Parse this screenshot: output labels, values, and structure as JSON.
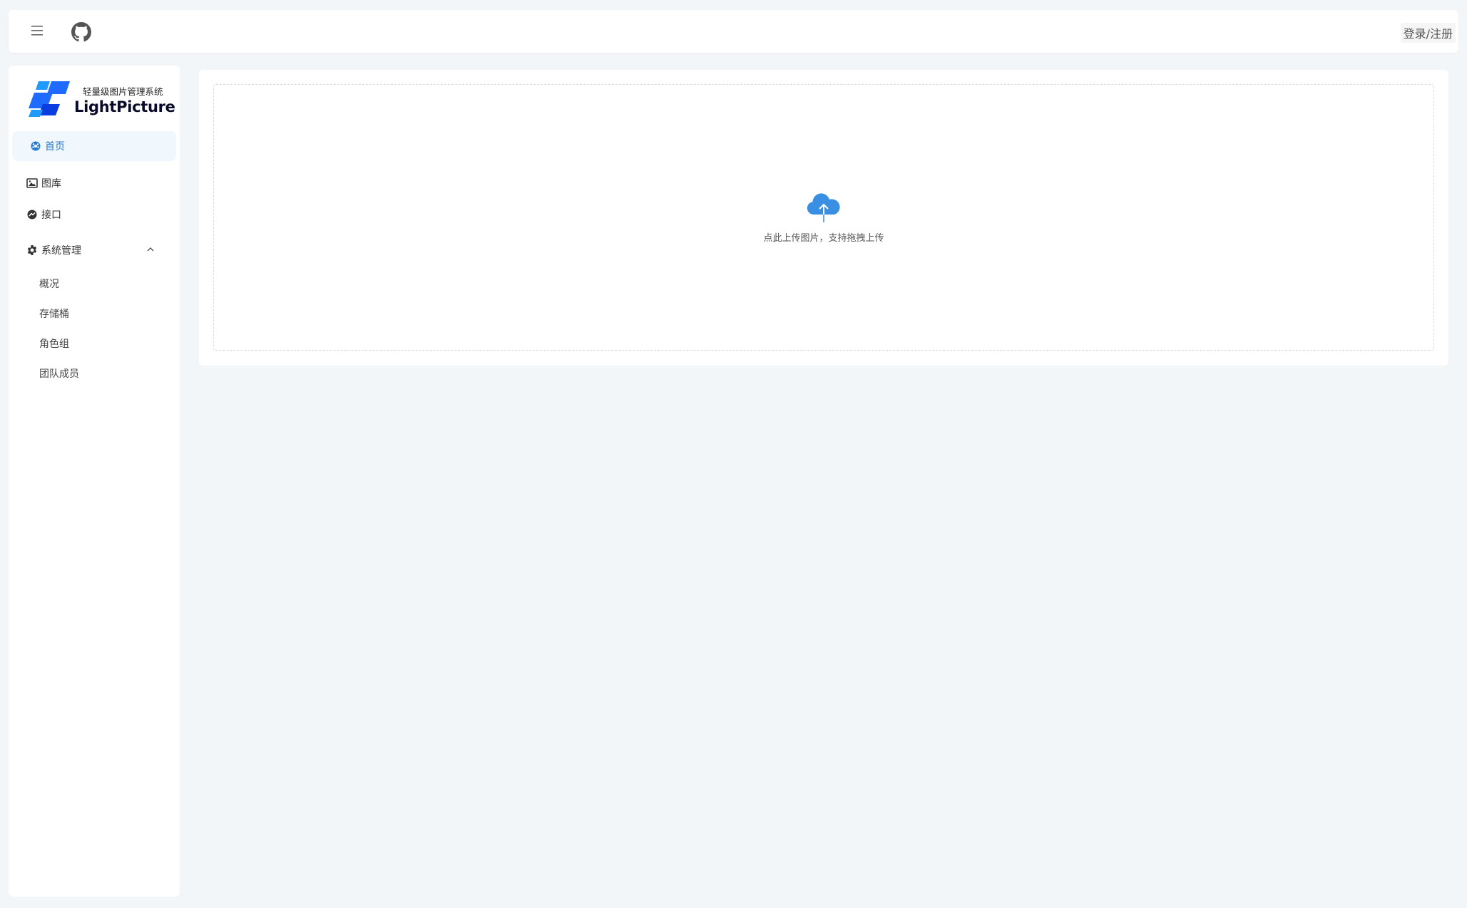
{
  "header": {
    "login_label": "登录/注册"
  },
  "brand": {
    "subtitle": "轻量级图片管理系统",
    "title": "LightPicture",
    "accent": "#1f6bff"
  },
  "sidebar": {
    "items": [
      {
        "label": "首页",
        "icon": "dashboard-icon",
        "active": true
      },
      {
        "label": "图库",
        "icon": "image-icon"
      },
      {
        "label": "接口",
        "icon": "messenger-icon"
      },
      {
        "label": "系统管理",
        "icon": "gear-icon",
        "expanded": true,
        "children": [
          "概况",
          "存储桶",
          "角色组",
          "团队成员"
        ]
      }
    ]
  },
  "upload": {
    "hint": "点此上传图片，支持拖拽上传",
    "icon": "cloud-upload-icon",
    "icon_color": "#3b8fe3"
  }
}
